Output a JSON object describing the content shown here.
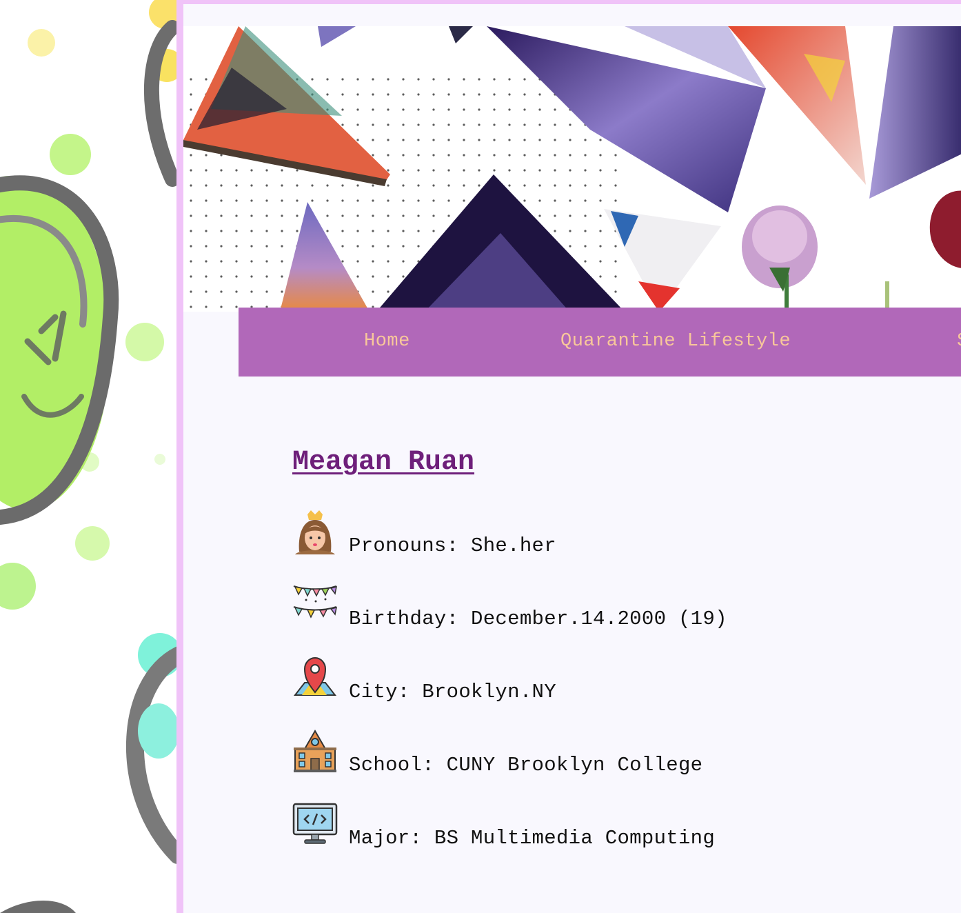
{
  "nav": {
    "items": [
      {
        "label": "Home"
      },
      {
        "label": "Quarantine Lifestyle"
      },
      {
        "label": "S"
      }
    ]
  },
  "profile": {
    "name": "Meagan Ruan",
    "rows": [
      {
        "icon": "princess-icon",
        "text": "Pronouns: She.her"
      },
      {
        "icon": "party-bunting-icon",
        "text": "Birthday: December.14.2000 (19)"
      },
      {
        "icon": "map-pin-icon",
        "text": "City: Brooklyn.NY"
      },
      {
        "icon": "school-building-icon",
        "text": "School: CUNY Brooklyn College"
      },
      {
        "icon": "code-monitor-icon",
        "text": "Major: BS Multimedia Computing"
      }
    ]
  },
  "colors": {
    "frame": "#f0c3f8",
    "card_bg": "#f9f8fe",
    "nav_bg": "#b168b9",
    "nav_text": "#f8c79a",
    "name_color": "#6e1f7a"
  }
}
